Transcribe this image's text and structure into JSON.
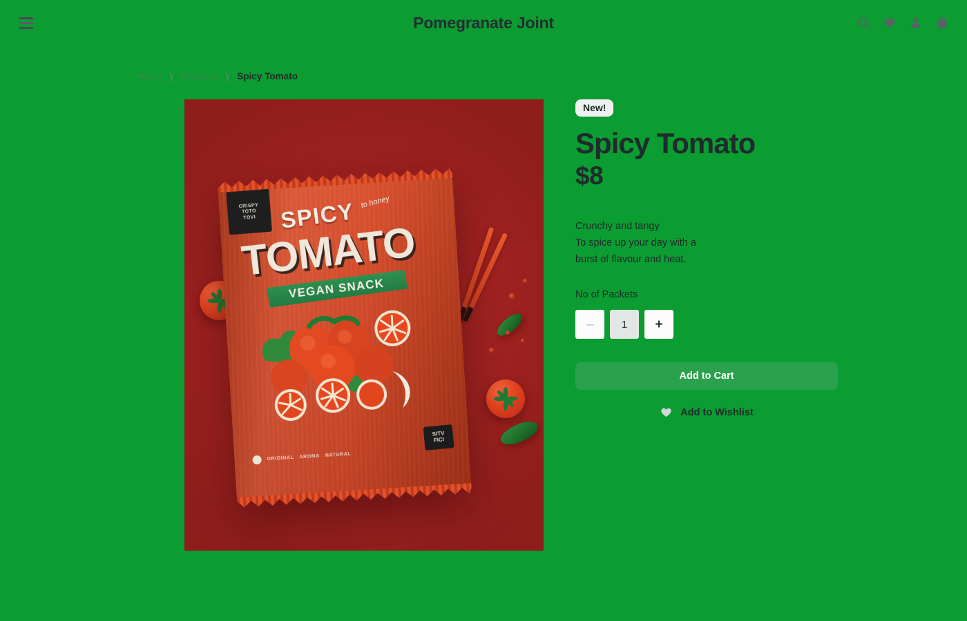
{
  "header": {
    "menu_icon": "hamburger-menu-icon",
    "brand_title": "Pomegranate Joint",
    "actions": [
      {
        "name": "search-icon",
        "label": "Search"
      },
      {
        "name": "heart-icon",
        "label": "Wishlist"
      },
      {
        "name": "user-icon",
        "label": "Account"
      },
      {
        "name": "shopping-bag-icon",
        "label": "Cart"
      }
    ]
  },
  "breadcrumb": {
    "home": "Home",
    "products": "Products",
    "current": "Spicy Tomato",
    "separator": "❯"
  },
  "gallery": {
    "packet": {
      "tab_line1": "CRISPY",
      "tab_line2": "TOTO",
      "tab_line3": "TOVI",
      "spicy": "SPICY",
      "honey": "to honey",
      "tomato": "TOMATO",
      "ribbon": "VEGAN SNACK",
      "footer_dot_text": "ORIGINAL",
      "footer_mid_text": "AROMA",
      "footer_right_text": "NATURAL",
      "badge_line1": "SITV",
      "badge_line2": "FICI"
    },
    "background_color": "#9d2120"
  },
  "product": {
    "badge": "New!",
    "title": "Spicy Tomato",
    "price": "$8",
    "description": [
      "Crunchy and tangy",
      "To spice up your day with a",
      "burst of flavour and heat."
    ],
    "quantity_label": "No of Packets",
    "quantity_value": "1",
    "decrease_label": "–",
    "increase_label": "+",
    "add_to_cart_label": "Add to Cart",
    "wishlist_label": "Add to Wishlist",
    "wishlist_icon": "heart-icon"
  },
  "colors": {
    "page_background": "#0b9c32",
    "accent_button": "#2aa14c",
    "text_dark": "#1f2b2c",
    "badge_background": "#eef1f0",
    "image_background": "#9d2120"
  }
}
